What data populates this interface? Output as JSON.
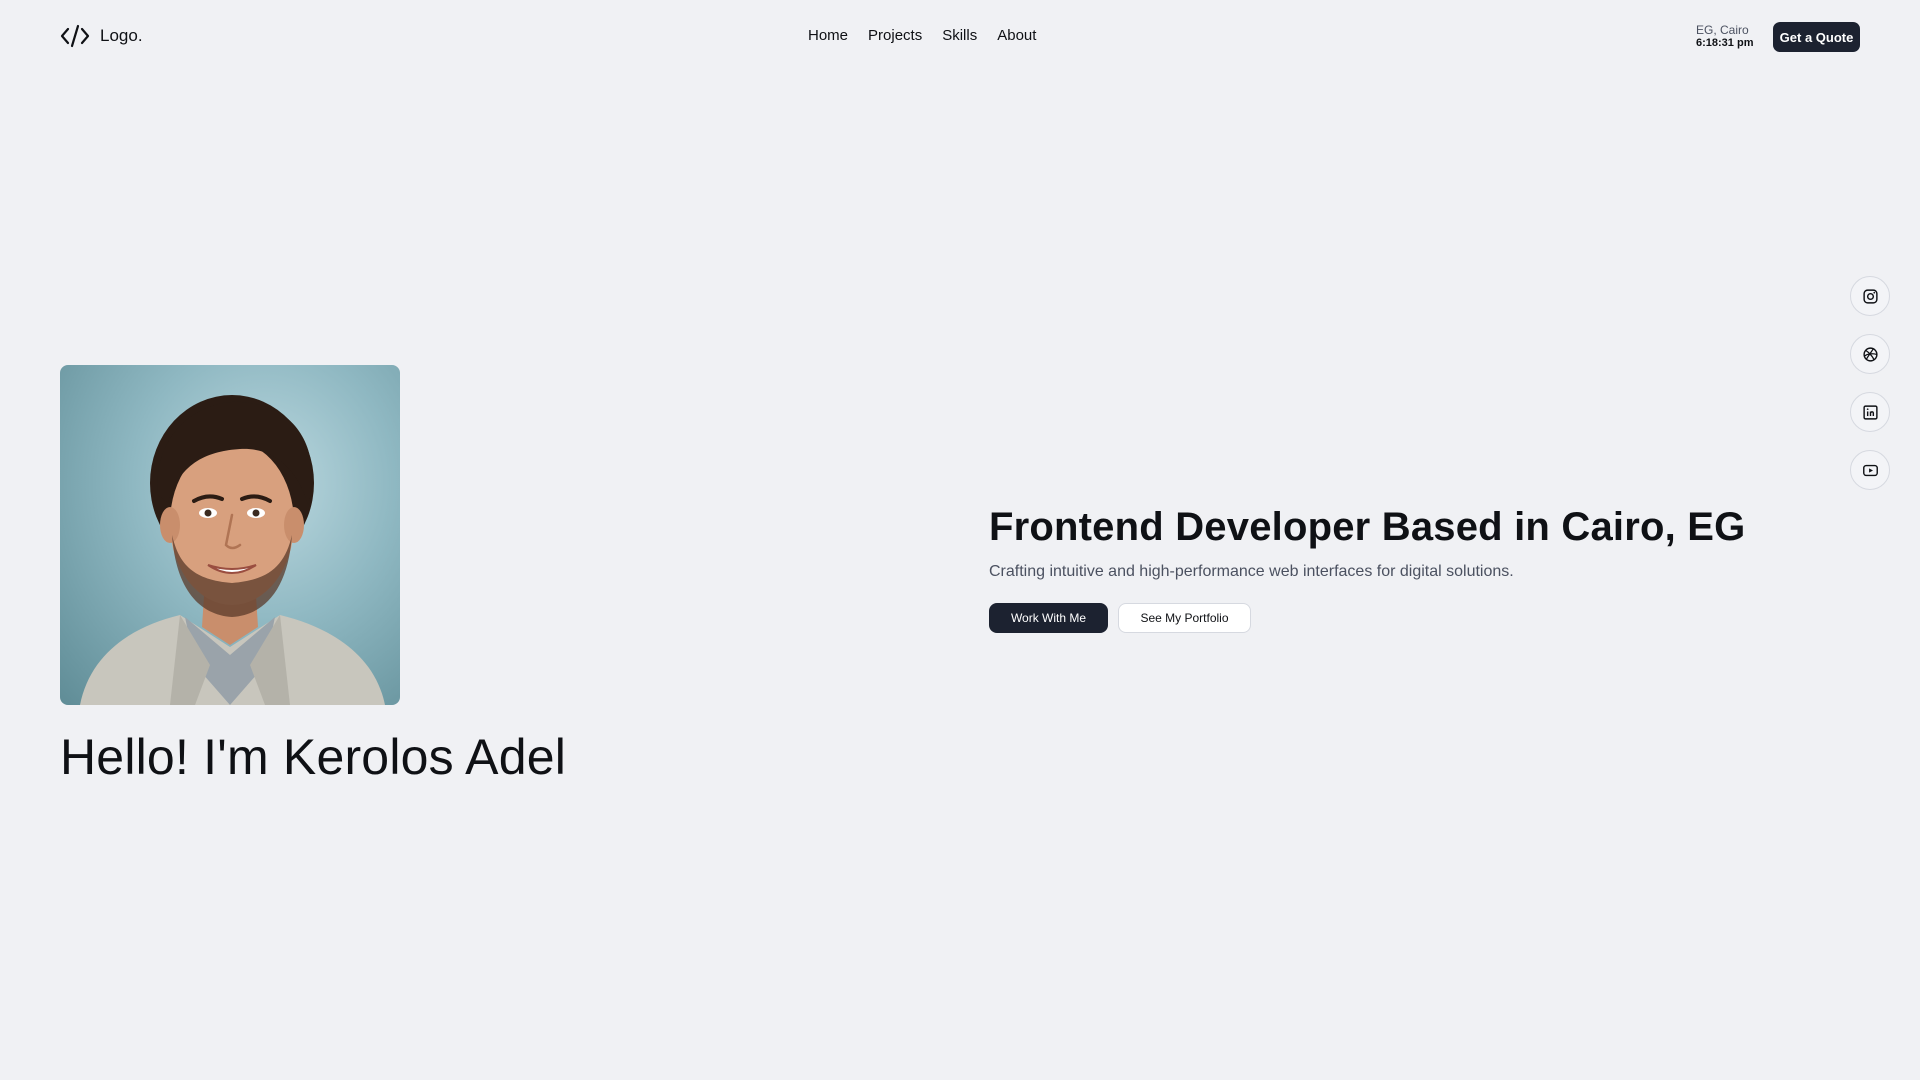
{
  "header": {
    "logo_text": "Logo.",
    "logo_icon": "code-brackets-icon",
    "nav": [
      "Home",
      "Projects",
      "Skills",
      "About"
    ],
    "location": {
      "city": "EG, Cairo",
      "time": "6:18:31 pm"
    },
    "cta_label": "Get a Quote"
  },
  "hero": {
    "greeting": "Hello! I'm Kerolos Adel",
    "title": "Frontend Developer Based in Cairo, EG",
    "subtitle": "Crafting intuitive and high-performance web interfaces for digital solutions.",
    "primary_button": "Work With Me",
    "secondary_button": "See My Portfolio"
  },
  "social": [
    {
      "icon": "instagram-icon"
    },
    {
      "icon": "dribbble-icon"
    },
    {
      "icon": "linkedin-icon"
    },
    {
      "icon": "youtube-icon"
    }
  ],
  "colors": {
    "background": "#f0f1f4",
    "primary_dark": "#1c2230",
    "text": "#0f1115",
    "muted_text": "#4b5160"
  }
}
